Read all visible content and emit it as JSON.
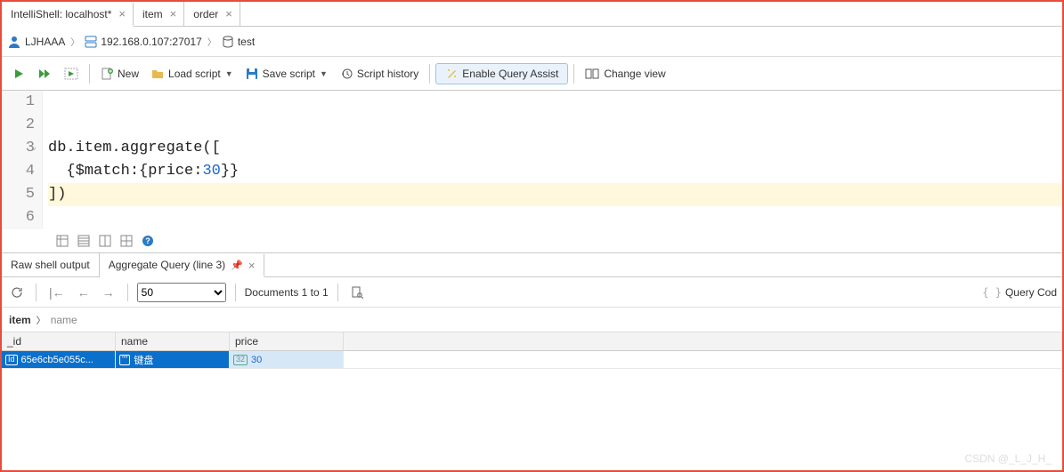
{
  "tabs": [
    {
      "label": "IntelliShell: localhost*",
      "active": true
    },
    {
      "label": "item",
      "active": false
    },
    {
      "label": "order",
      "active": false
    }
  ],
  "breadcrumb": {
    "user": "LJHAAA",
    "host": "192.168.0.107:27017",
    "db": "test"
  },
  "toolbar": {
    "new": "New",
    "load": "Load script",
    "save": "Save script",
    "history": "Script history",
    "assist": "Enable Query Assist",
    "change_view": "Change view"
  },
  "editor": {
    "lines": [
      "1",
      "2",
      "3",
      "4",
      "5",
      "6"
    ],
    "code": {
      "l3_a": "db.item.aggregate([",
      "l4_pre": "  {$match:{price:",
      "l4_num": "30",
      "l4_post": "}}",
      "l5": "])"
    }
  },
  "result_tabs": {
    "raw": "Raw shell output",
    "agg": "Aggregate Query (line 3)"
  },
  "res_toolbar": {
    "limit_value": "50",
    "doc_text": "Documents 1 to 1",
    "query_code": "Query Cod"
  },
  "bc2": {
    "collection": "item",
    "field": "name"
  },
  "table": {
    "headers": [
      "_id",
      "name",
      "price"
    ],
    "row": {
      "id_badge": "Id",
      "id": "65e6cb5e055c...",
      "name_type_icon": "\"\"",
      "name": "键盘",
      "price_badge": "32",
      "price": "30"
    }
  },
  "watermark": "CSDN @_L_J_H_"
}
